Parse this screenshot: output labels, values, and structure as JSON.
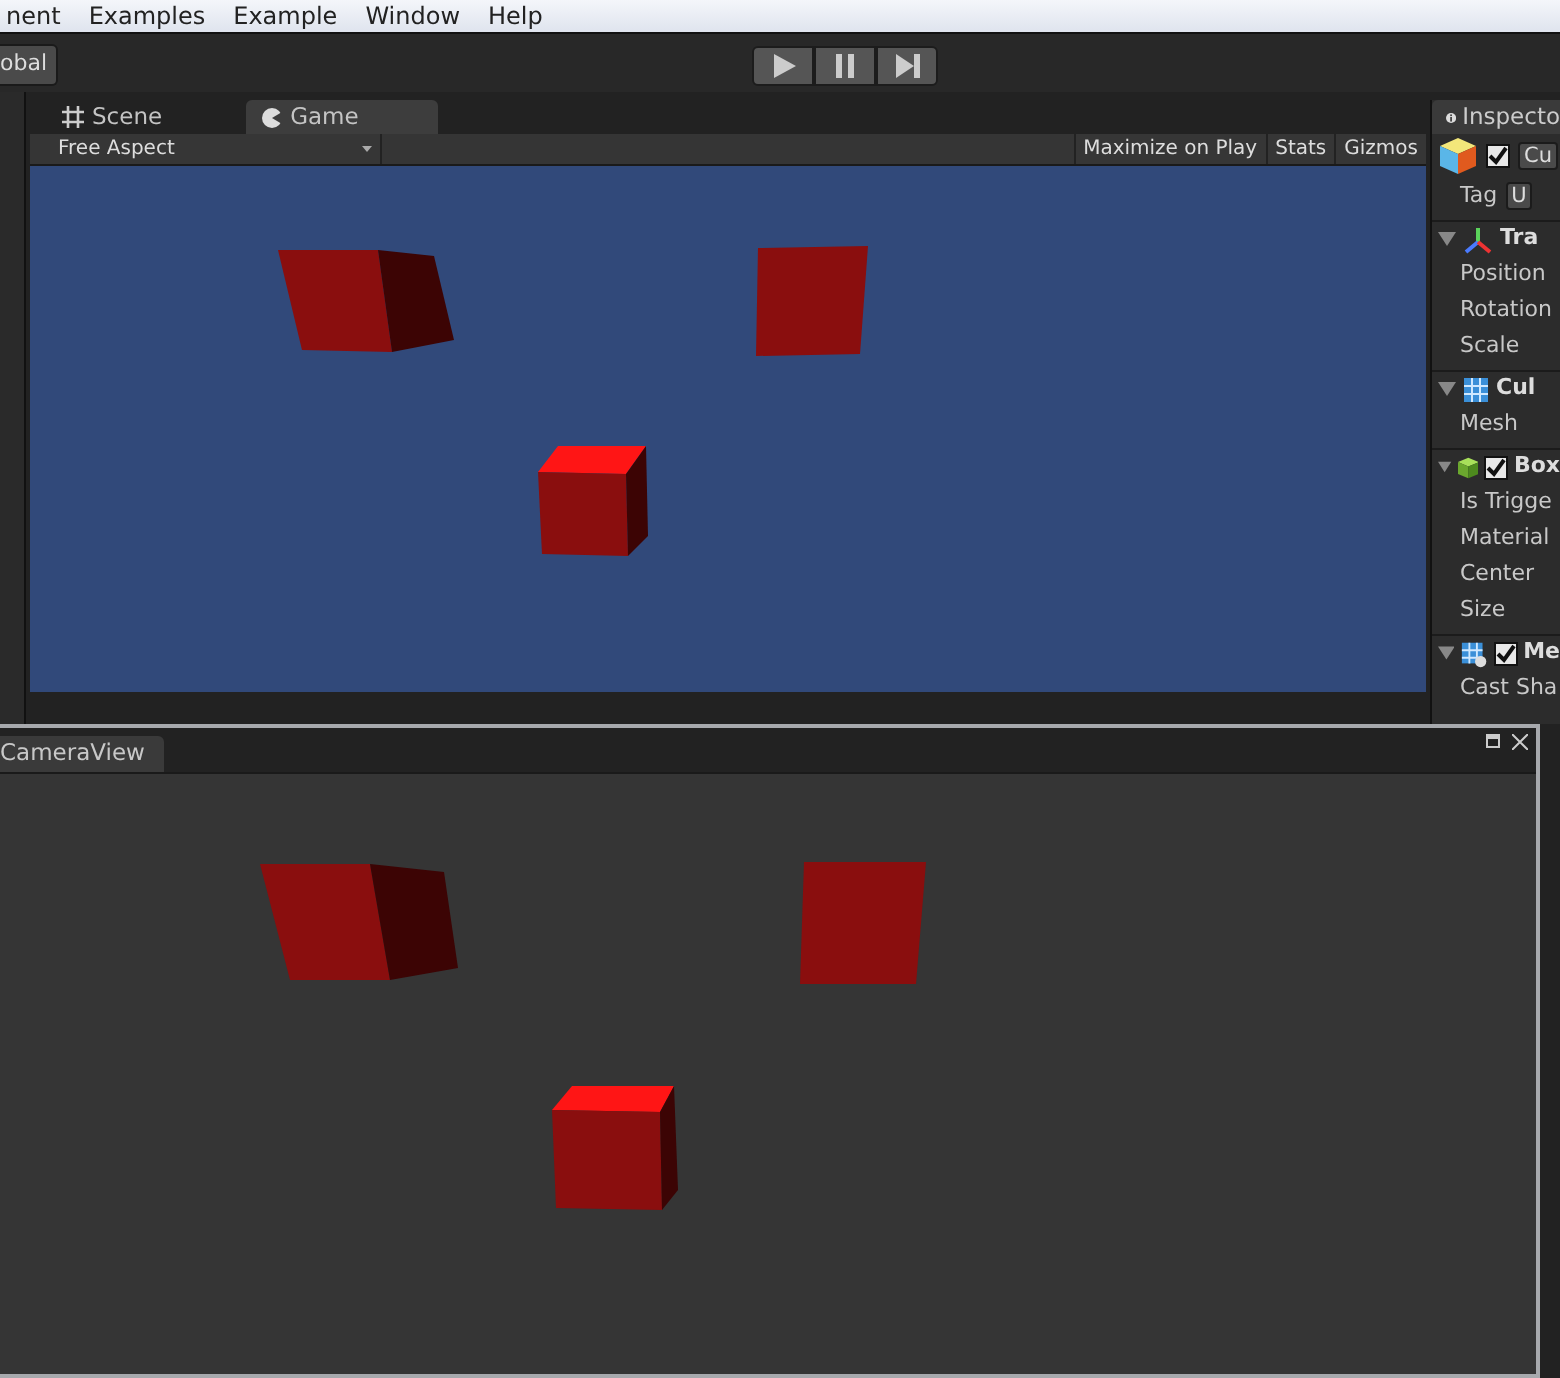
{
  "menu_bar": [
    "nent",
    "Examples",
    "Example",
    "Window",
    "Help"
  ],
  "toolbar": {
    "pivot_button": "obal"
  },
  "scene_tabs": [
    {
      "label": "Scene",
      "selected": false,
      "kind": "scene"
    },
    {
      "label": "Game",
      "selected": true,
      "kind": "game"
    }
  ],
  "game_toolbar": {
    "aspect": "Free Aspect",
    "buttons": [
      "Maximize on Play",
      "Stats",
      "Gizmos"
    ]
  },
  "inspector": {
    "tab_title": "Inspecto",
    "object_active": true,
    "object_name": "Cu",
    "tag_label": "Tag",
    "tag_value": "U",
    "components": [
      {
        "kind": "transform",
        "title": "Tra",
        "fields": [
          "Position",
          "Rotation",
          "Scale"
        ]
      },
      {
        "kind": "mesh",
        "title": "Cul",
        "fields": [
          "Mesh"
        ]
      },
      {
        "kind": "collider",
        "title": "Box",
        "checked": true,
        "fields": [
          "Is Trigge",
          "Material",
          "Center",
          "Size"
        ]
      },
      {
        "kind": "renderer",
        "title": "Me",
        "checked": true,
        "fields": [
          "Cast Sha"
        ]
      }
    ]
  },
  "camera_window": {
    "tab_title": "CameraView"
  }
}
